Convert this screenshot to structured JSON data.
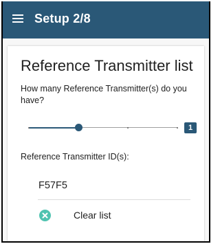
{
  "header": {
    "title": "Setup 2/8",
    "menu_icon": "hamburger-menu-icon",
    "background_color": "#2a5877"
  },
  "main": {
    "title": "Reference Transmitter list",
    "question": "How many Reference Transmitter(s) do you have?",
    "slider": {
      "min": 0,
      "max": 3,
      "value": 1,
      "value_label": "1",
      "accent_color": "#2a5877"
    },
    "ids_label": "Reference Transmitter ID(s):",
    "ids": [
      "F57F5"
    ],
    "clear_label": "Clear list",
    "clear_icon": "clear-circle-x-icon",
    "clear_icon_color": "#4fc3b0"
  }
}
